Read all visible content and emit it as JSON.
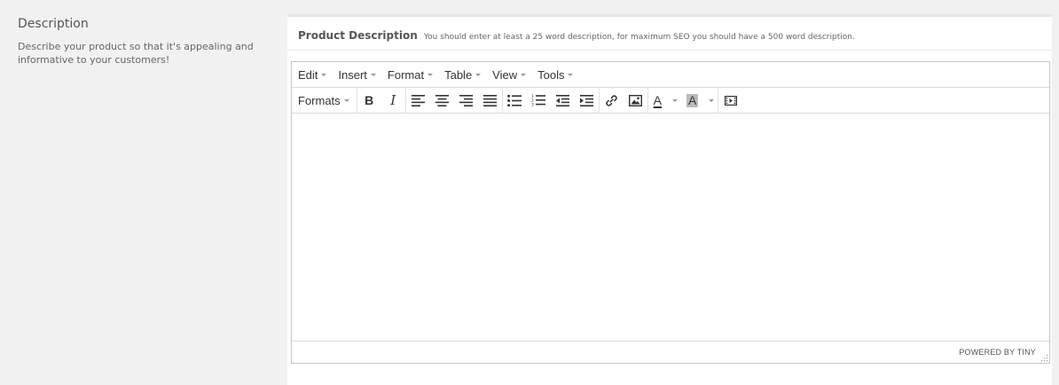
{
  "section": {
    "title": "Description",
    "description": "Describe your product so that it's appealing and informative to your customers!"
  },
  "panel": {
    "title": "Product Description",
    "hint": "You should enter at least a 25 word description, for maximum SEO you should have a 500 word description."
  },
  "menubar": {
    "items": [
      "Edit",
      "Insert",
      "Format",
      "Table",
      "View",
      "Tools"
    ]
  },
  "toolbar": {
    "formats_label": "Formats",
    "bold_label": "B",
    "italic_label": "I",
    "text_color_label": "A",
    "bg_color_label": "A",
    "icons": [
      "bold-icon",
      "italic-icon",
      "align-left-icon",
      "align-center-icon",
      "align-right-icon",
      "align-justify-icon",
      "bullet-list-icon",
      "numbered-list-icon",
      "outdent-icon",
      "indent-icon",
      "link-icon",
      "image-icon",
      "text-color-icon",
      "background-color-icon",
      "media-icon"
    ],
    "colors": {
      "text_color": "#333333",
      "bg_color": "#bbbbbb"
    }
  },
  "editor": {
    "content": "",
    "powered_by": "POWERED BY TINY"
  }
}
